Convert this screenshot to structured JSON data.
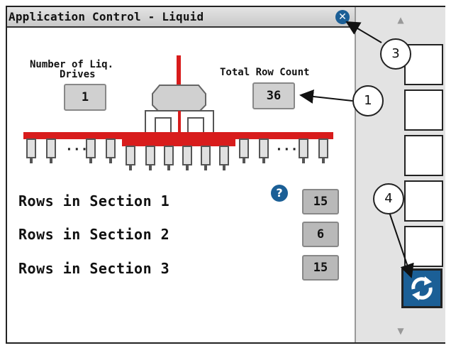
{
  "window": {
    "title": "Application Control - Liquid"
  },
  "drives": {
    "label_line1": "Number of Liq.",
    "label_line2": "Drives",
    "value": "1"
  },
  "row_count": {
    "label": "Total Row Count",
    "value": "36"
  },
  "sections": [
    {
      "label": "Rows in Section 1",
      "value": "15"
    },
    {
      "label": "Rows in Section 2",
      "value": "6"
    },
    {
      "label": "Rows in Section 3",
      "value": "15"
    }
  ],
  "implement": {
    "dots_left": "···",
    "dots_right": "···"
  },
  "callouts": [
    "1",
    "3",
    "4"
  ],
  "colors": {
    "accent": "#1b5f96",
    "boom": "#d81c1c"
  },
  "icons": {
    "close": "close-icon",
    "help": "help-icon",
    "refresh": "refresh-icon",
    "up": "arrow-up-icon",
    "down": "arrow-down-icon"
  }
}
